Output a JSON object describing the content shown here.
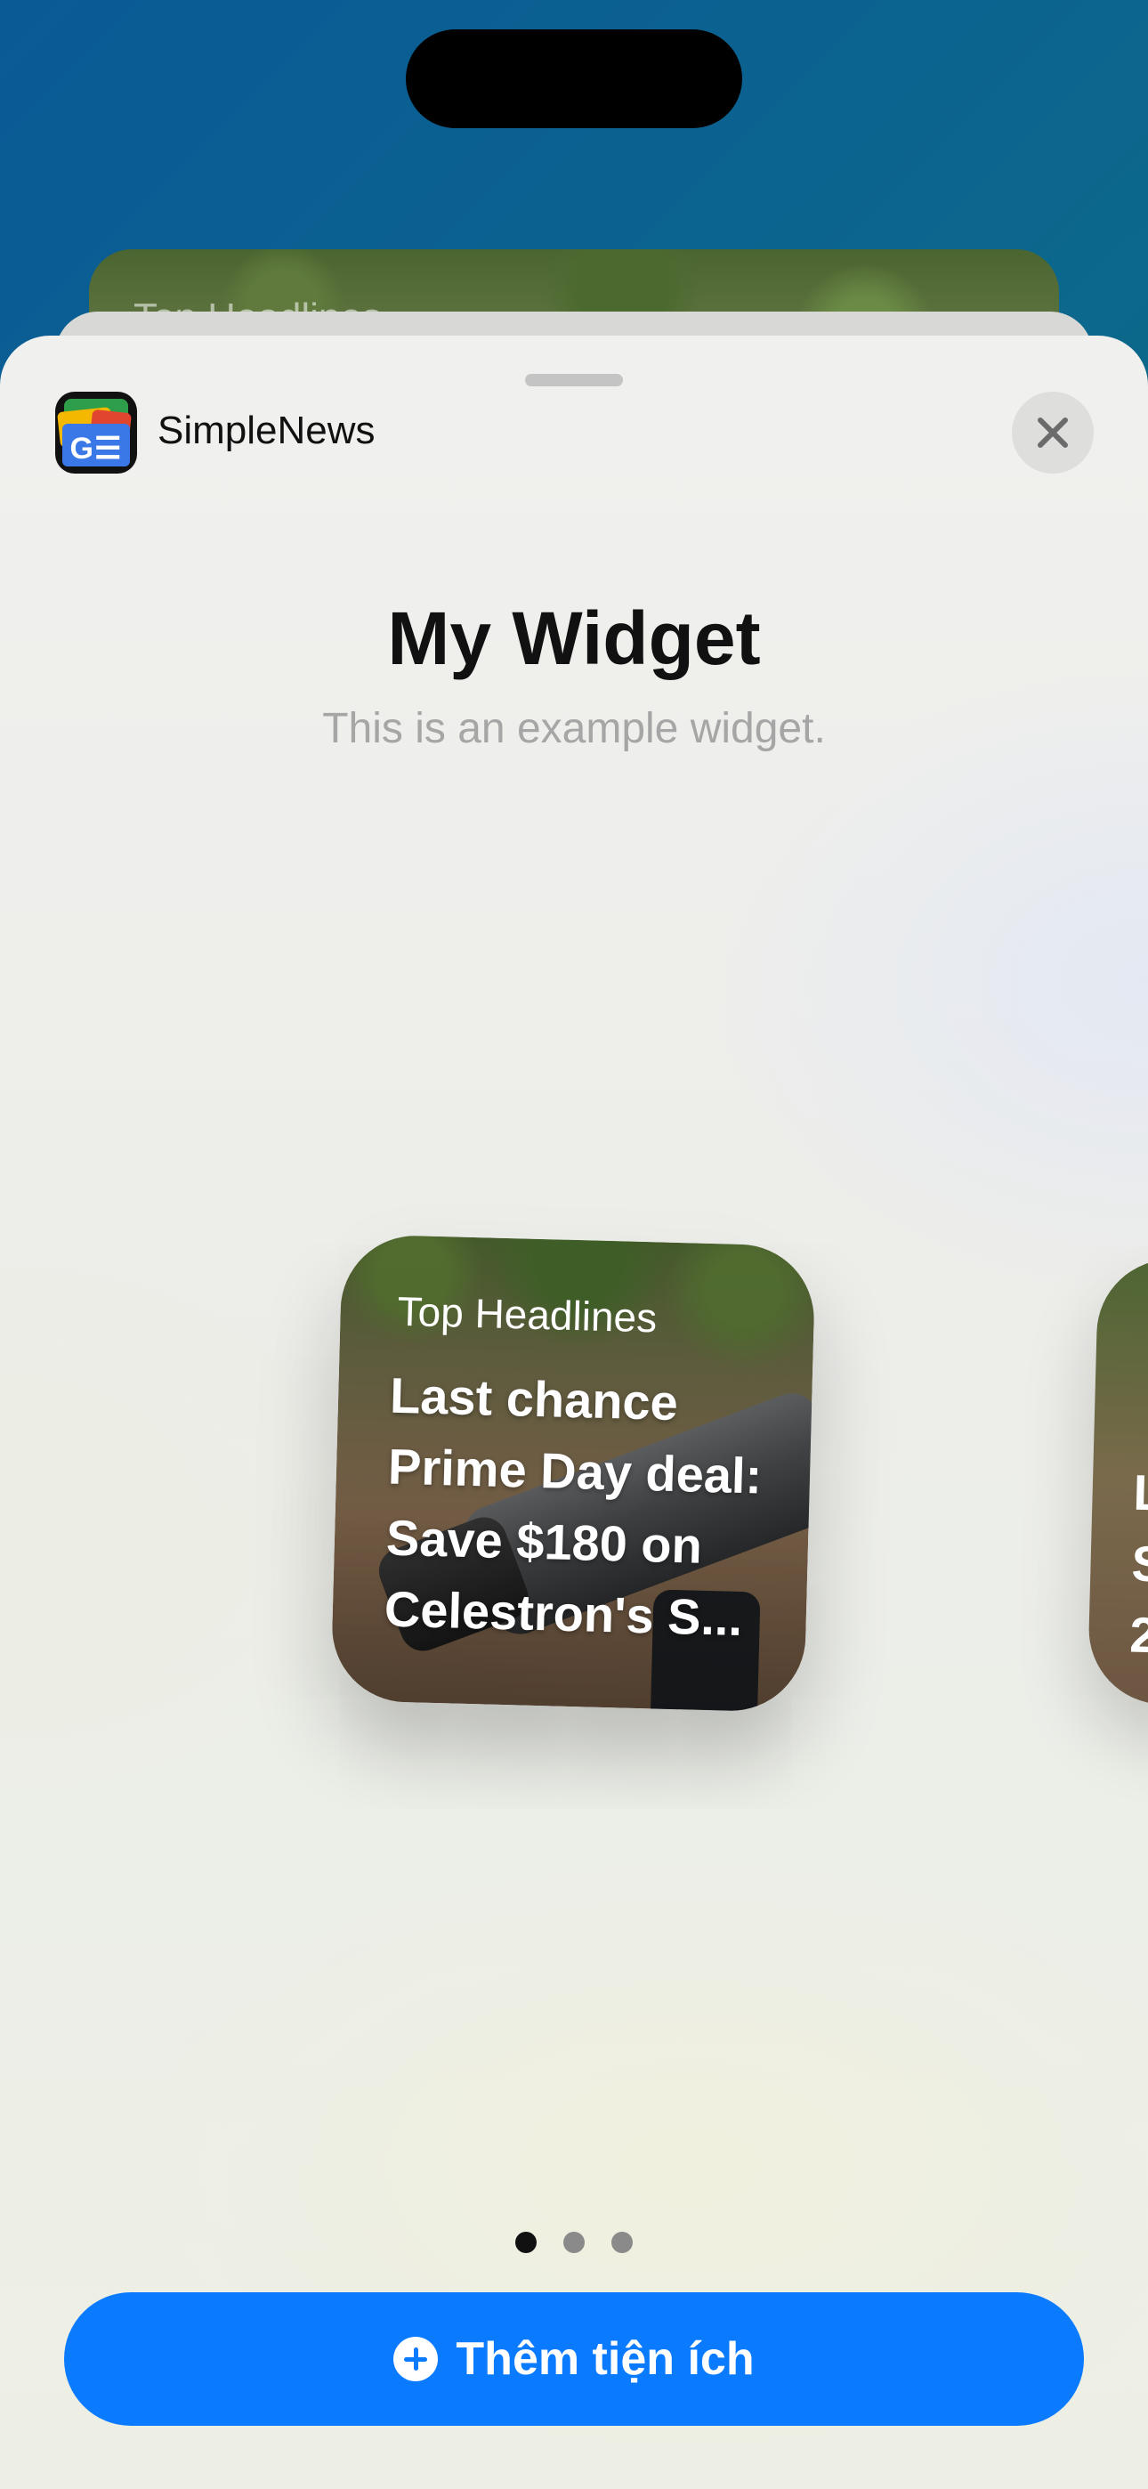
{
  "header": {
    "app_name": "SimpleNews",
    "close_label": "✕"
  },
  "widget": {
    "title": "My Widget",
    "subtitle": "This is an example widget.",
    "preview": {
      "label": "Top Headlines",
      "headline": "Last chance Prime Day deal: Save $180 on Celestron's S..."
    },
    "next_preview_fragments": [
      "L",
      "S",
      "2"
    ]
  },
  "background_card": {
    "label": "Top Headlines"
  },
  "pagination": {
    "count": 3,
    "active_index": 0
  },
  "action": {
    "add_label": "Thêm tiện ích"
  },
  "colors": {
    "accent": "#0a7aff",
    "title_text": "#111111",
    "subtitle_text": "#a6a6a6"
  }
}
